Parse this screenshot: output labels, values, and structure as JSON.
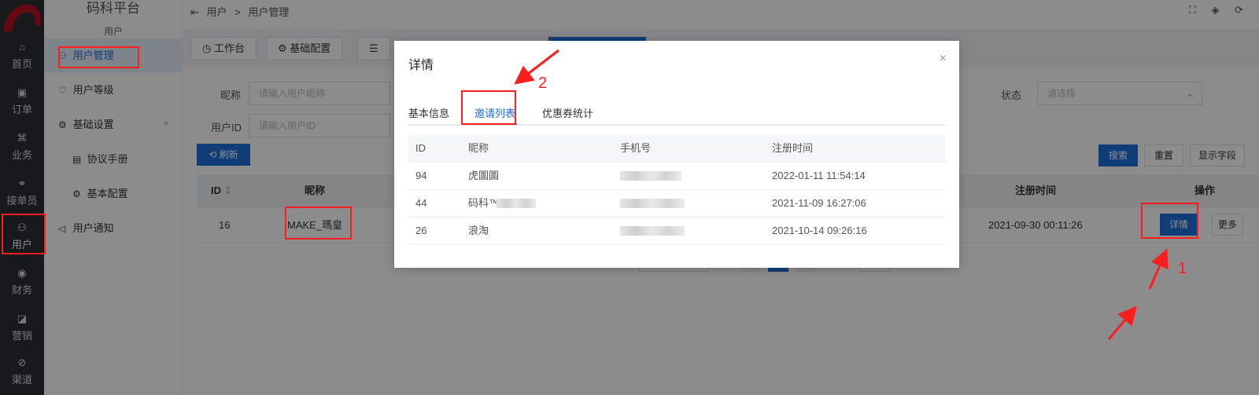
{
  "app": {
    "brand": "码科平台",
    "section": "用户"
  },
  "rail": [
    {
      "label": "首页",
      "icon": "⌂"
    },
    {
      "label": "订单",
      "icon": "▣"
    },
    {
      "label": "业务",
      "icon": "⌘"
    },
    {
      "label": "接单员",
      "icon": "⚭"
    },
    {
      "label": "用户",
      "icon": "⚇"
    },
    {
      "label": "财务",
      "icon": "◉"
    },
    {
      "label": "营销",
      "icon": "◪"
    },
    {
      "label": "渠道",
      "icon": "⊘"
    }
  ],
  "sidebar": {
    "items": [
      {
        "label": "用户管理",
        "icon": "⚇"
      },
      {
        "label": "用户等级",
        "icon": "♡"
      },
      {
        "label": "基础设置",
        "icon": "⚙"
      },
      {
        "label": "协议手册",
        "icon": "▤"
      },
      {
        "label": "基本配置",
        "icon": "⚙"
      },
      {
        "label": "用户通知",
        "icon": "◁"
      }
    ],
    "caret": "^"
  },
  "topbar": {
    "crumb_toggle": "⇤",
    "crumb_root": "用户",
    "crumb_sep": ">",
    "crumb_current": "用户管理",
    "tool_icons": "⛶ ◈ ⟳"
  },
  "tabs": [
    {
      "label": "工作台",
      "icon": "◷"
    },
    {
      "label": "基础配置",
      "icon": "⚙"
    },
    {
      "label": "",
      "icon": "☰"
    }
  ],
  "filters": {
    "nickname_label": "昵称",
    "nickname_placeholder": "请输入用户昵称",
    "userid_label": "用户ID",
    "userid_placeholder": "请输入用户ID",
    "status_label": "状态",
    "status_placeholder": "请选择"
  },
  "buttons": {
    "refresh": "刷新",
    "search": "搜索",
    "reset": "重置",
    "show_search": "显示字段",
    "detail": "详情",
    "more": "更多"
  },
  "table": {
    "headers": {
      "id": "ID",
      "nickname": "昵称",
      "register_time": "注册时间",
      "actions": "操作"
    },
    "rows": [
      {
        "id": "16",
        "nickname": "MAKE_瑪皇",
        "register_time": "2021-09-30 00:11:26"
      }
    ]
  },
  "dialog": {
    "title": "详情",
    "close": "×",
    "tabs": [
      "基本信息",
      "邀请列表",
      "优惠券统计"
    ],
    "active_tab": 1,
    "columns": [
      "ID",
      "昵称",
      "手机号",
      "注册时间"
    ],
    "rows": [
      {
        "id": "94",
        "nickname": "虎圖圖",
        "register_time": "2022-01-11 11:54:14"
      },
      {
        "id": "44",
        "nickname": "码科™",
        "register_time": "2021-11-09 16:27:06"
      },
      {
        "id": "26",
        "nickname": "浪淘",
        "register_time": "2021-10-14 09:26:16"
      }
    ]
  },
  "annotations": {
    "one": "1",
    "two": "2"
  },
  "colors": {
    "primary": "#1e6fd9",
    "annotation": "#ff1e1e",
    "rail": "#2b2f36"
  }
}
